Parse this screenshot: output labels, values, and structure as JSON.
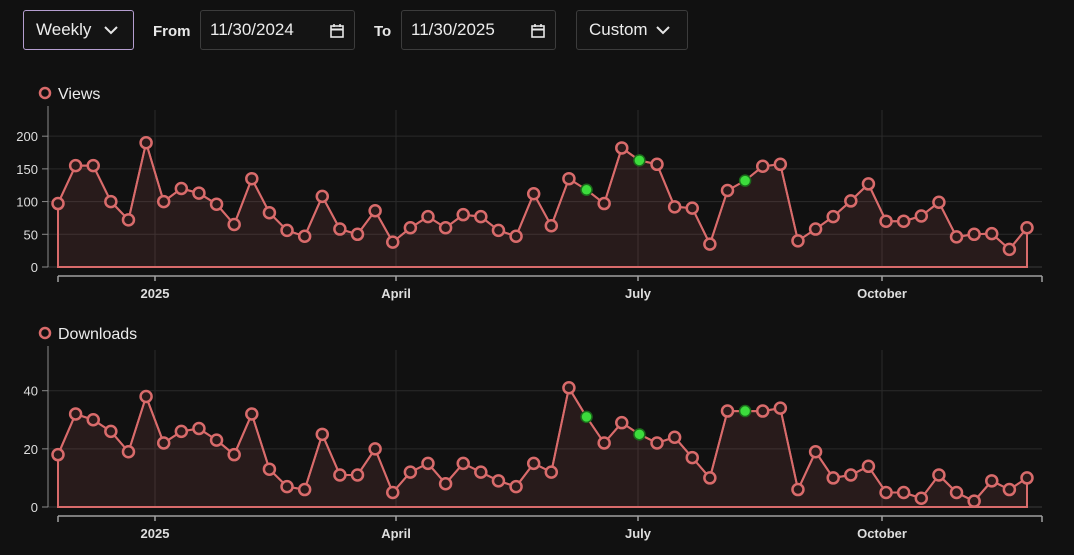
{
  "controls": {
    "interval": "Weekly",
    "from_label": "From",
    "from_value": "11/30/2024",
    "to_label": "To",
    "to_value": "11/30/2025",
    "range": "Custom"
  },
  "colors": {
    "line": "#d96b6b",
    "highlight": "#3cdc3c",
    "background": "#111111"
  },
  "chart_data": [
    {
      "type": "line",
      "series": [
        {
          "name": "Views",
          "values": [
            97,
            155,
            155,
            100,
            72,
            190,
            100,
            120,
            113,
            96,
            65,
            135,
            83,
            56,
            47,
            108,
            58,
            50,
            86,
            38,
            60,
            77,
            60,
            80,
            77,
            56,
            47,
            112,
            63,
            135,
            118,
            97,
            182,
            163,
            157,
            92,
            90,
            35,
            117,
            132,
            154,
            157,
            40,
            58,
            77,
            101,
            127,
            70,
            70,
            78,
            99,
            46,
            50,
            51,
            27,
            60
          ]
        }
      ],
      "highlight_indices": [
        30,
        33,
        39
      ],
      "x_ticks": [
        "2025",
        "April",
        "July",
        "October"
      ],
      "yticks": [
        0,
        50,
        100,
        150,
        200
      ],
      "ylim": [
        0,
        240
      ]
    },
    {
      "type": "line",
      "series": [
        {
          "name": "Downloads",
          "values": [
            18,
            32,
            30,
            26,
            19,
            38,
            22,
            26,
            27,
            23,
            18,
            32,
            13,
            7,
            6,
            25,
            11,
            11,
            20,
            5,
            12,
            15,
            8,
            15,
            12,
            9,
            7,
            15,
            12,
            41,
            31,
            22,
            29,
            25,
            22,
            24,
            17,
            10,
            33,
            33,
            33,
            34,
            6,
            19,
            10,
            11,
            14,
            5,
            5,
            3,
            11,
            5,
            2,
            9,
            6,
            10
          ]
        }
      ],
      "highlight_indices": [
        30,
        33,
        39
      ],
      "x_ticks": [
        "2025",
        "April",
        "July",
        "October"
      ],
      "yticks": [
        0,
        20,
        40
      ],
      "ylim": [
        0,
        54
      ]
    }
  ]
}
